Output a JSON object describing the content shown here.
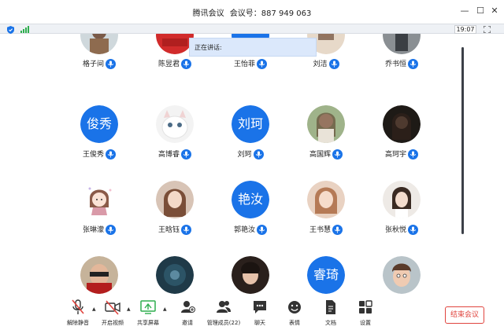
{
  "window": {
    "app_name": "腾讯会议",
    "meeting_id_label": "会议号：887 949 063",
    "min_symbol": "—",
    "max_symbol": "☐",
    "close_symbol": "✕"
  },
  "status": {
    "timer": "19:07",
    "shield_icon": "shield-icon",
    "signal_icon": "signal-bars-icon",
    "fullscreen_icon": "fullscreen-icon"
  },
  "speaking_label": "正在讲话:",
  "colors": {
    "accent": "#1a73e8",
    "end_red": "#e0443e",
    "camera_red": "#e0443e",
    "share_green": "#2fae4e"
  },
  "participants": [
    {
      "name": "格子间",
      "avatar_type": "photo"
    },
    {
      "name": "陈昱君",
      "avatar_type": "photo"
    },
    {
      "name": "王怡菲",
      "avatar_type": "photo"
    },
    {
      "name": "刘洁",
      "avatar_type": "photo"
    },
    {
      "name": "乔书恒",
      "avatar_type": "photo"
    },
    {
      "name": "王俊秀",
      "avatar_type": "text",
      "avatar_text": "俊秀"
    },
    {
      "name": "高博睿",
      "avatar_type": "photo"
    },
    {
      "name": "刘珂",
      "avatar_type": "text",
      "avatar_text": "刘珂"
    },
    {
      "name": "高国辉",
      "avatar_type": "photo"
    },
    {
      "name": "高珂宇",
      "avatar_type": "photo"
    },
    {
      "name": "张琳濛",
      "avatar_type": "photo"
    },
    {
      "name": "王晗钰",
      "avatar_type": "photo"
    },
    {
      "name": "郭艳汝",
      "avatar_type": "text",
      "avatar_text": "艳汝"
    },
    {
      "name": "王书慧",
      "avatar_type": "photo"
    },
    {
      "name": "张秋悦",
      "avatar_type": "photo"
    },
    {
      "name": "",
      "avatar_type": "photo"
    },
    {
      "name": "",
      "avatar_type": "photo"
    },
    {
      "name": "",
      "avatar_type": "photo"
    },
    {
      "name": "",
      "avatar_type": "text",
      "avatar_text": "睿琦"
    },
    {
      "name": "",
      "avatar_type": "photo"
    }
  ],
  "toolbar": {
    "mute_all": "解除静音",
    "start_video": "开启视频",
    "share_screen": "共享屏幕",
    "invite": "邀请",
    "manage_members": "管理成员(22)",
    "chat": "聊天",
    "reactions": "表情",
    "docs": "文档",
    "settings": "设置",
    "end_meeting": "结束会议",
    "caret": "▲"
  }
}
